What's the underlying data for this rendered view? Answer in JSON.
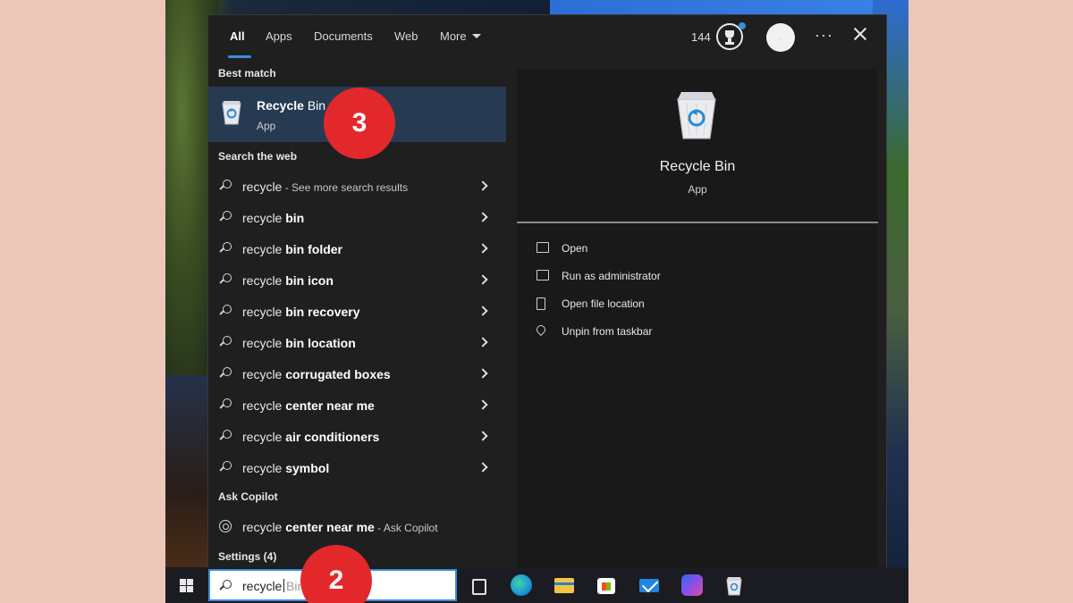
{
  "tabs": [
    "All",
    "Apps",
    "Documents",
    "Web",
    "More"
  ],
  "header": {
    "points": "144",
    "avatar_text": "..."
  },
  "sections": {
    "best_match": "Best match",
    "search_web": "Search the web",
    "ask_copilot": "Ask Copilot",
    "settings": "Settings (4)"
  },
  "best_match": {
    "title_prefix": "Recycle",
    "title_suffix": " Bin",
    "subtitle": "App"
  },
  "web_results": [
    {
      "prefix": "recycle",
      "bold": "",
      "small": " - See more search results"
    },
    {
      "prefix": "recycle ",
      "bold": "bin",
      "small": ""
    },
    {
      "prefix": "recycle ",
      "bold": "bin folder",
      "small": ""
    },
    {
      "prefix": "recycle ",
      "bold": "bin icon",
      "small": ""
    },
    {
      "prefix": "recycle ",
      "bold": "bin recovery",
      "small": ""
    },
    {
      "prefix": "recycle ",
      "bold": "bin location",
      "small": ""
    },
    {
      "prefix": "recycle ",
      "bold": "corrugated boxes",
      "small": ""
    },
    {
      "prefix": "recycle ",
      "bold": "center near me",
      "small": ""
    },
    {
      "prefix": "recycle ",
      "bold": "air conditioners",
      "small": ""
    },
    {
      "prefix": "recycle ",
      "bold": "symbol",
      "small": ""
    }
  ],
  "copilot_result": {
    "prefix": "recycle ",
    "bold": "center near me",
    "small": " - Ask Copilot"
  },
  "preview": {
    "title": "Recycle Bin",
    "subtitle": "App",
    "actions": [
      "Open",
      "Run as administrator",
      "Open file location",
      "Unpin from taskbar"
    ]
  },
  "taskbar": {
    "search_value": "recycle",
    "search_suggestion": "Bin"
  },
  "markers": [
    "3",
    "2"
  ],
  "colors": {
    "accent": "#3a8dde",
    "selection": "#263b52",
    "marker": "#e3282c",
    "outer_bg": "#ebc7b9"
  },
  "icons": [
    "recycle-bin-icon",
    "search-icon",
    "chevron-right-icon",
    "copilot-icon",
    "trophy-icon",
    "close-icon",
    "windows-logo-icon",
    "edge-icon",
    "file-explorer-icon",
    "store-icon",
    "mail-icon"
  ]
}
